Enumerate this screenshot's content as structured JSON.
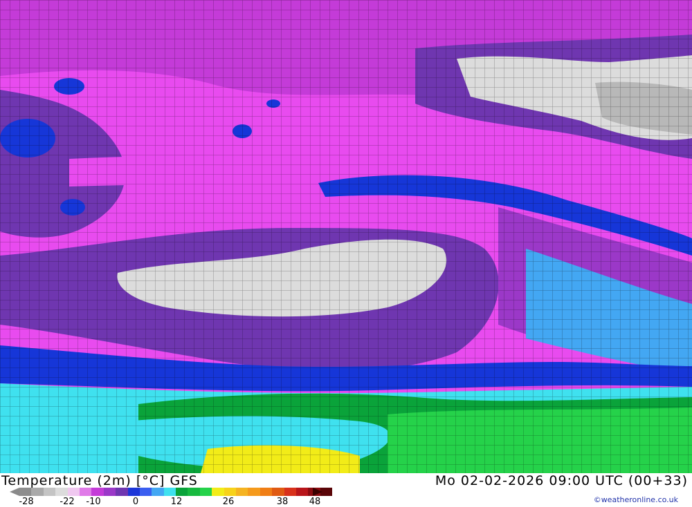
{
  "map": {
    "land_colors": {
      "hot": "#dcdcdc",
      "warm": "#6f36b0",
      "mid": "#c43bd8",
      "cool": "#e84bef",
      "blue_band": "#1636d8",
      "cold": "#43a7f3",
      "cyan": "#3fe1ef",
      "green": "#0aa33a",
      "light_green": "#25d24a",
      "yellow": "#f2ec18"
    }
  },
  "footer": {
    "title": "Temperature (2m) [°C] GFS",
    "datetime": "Mo 02-02-2026 09:00 UTC (00+33)",
    "credit": "©weatheronline.co.uk"
  },
  "scale": {
    "colors": [
      "#8e8e8e",
      "#a9a9a9",
      "#c4c4c4",
      "#dcdcdc",
      "#f0c8f0",
      "#e07ae8",
      "#c43bd8",
      "#9b38c8",
      "#6f36b0",
      "#1c36d8",
      "#3a5ef0",
      "#43a7f3",
      "#3fe1ef",
      "#0aa33a",
      "#17b93f",
      "#25d24a",
      "#f2ec18",
      "#f7d21a",
      "#f5b321",
      "#f59a1b",
      "#f07e15",
      "#e05a12",
      "#d8311b",
      "#b8151a",
      "#8c0a10",
      "#5a0508"
    ],
    "ticks": [
      "-28",
      "-22",
      "-10",
      "0",
      "12",
      "26",
      "38",
      "48"
    ]
  }
}
